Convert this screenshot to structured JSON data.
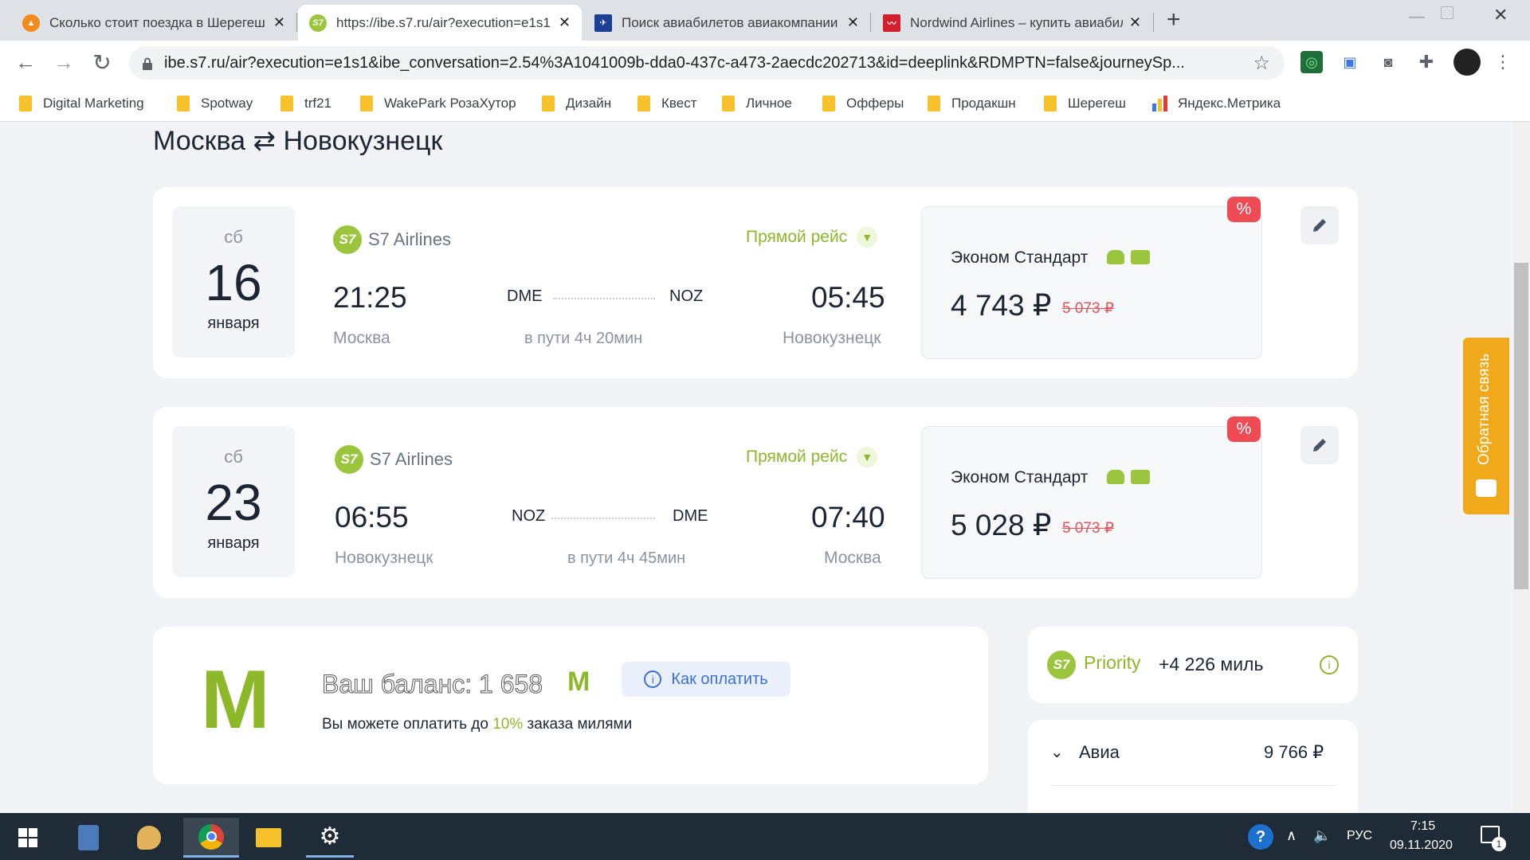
{
  "tabs": [
    {
      "title": "Сколько стоит поездка в Шерегеш",
      "favicon": "orange-circle-icon"
    },
    {
      "title": "https://ibe.s7.ru/air?execution=e1s1",
      "favicon": "s7-icon"
    },
    {
      "title": "Поиск авиабилетов авиакомпании",
      "favicon": "blue-plane-icon"
    },
    {
      "title": "Nordwind Airlines – купить авиабилеты",
      "favicon": "nordwind-icon"
    }
  ],
  "new_tab": "+",
  "url": "ibe.s7.ru/air?execution=e1s1&ibe_conversation=2.54%3A1041009b-dda0-437c-a473-2aecdc202713&id=deeplink&RDMPTN=false&journeySp...",
  "bookmarks": [
    "Digital Marketing",
    "Spotway",
    "trf21",
    "WakePark РозаХутор",
    "Дизайн",
    "Квест",
    "Личное",
    "Офферы",
    "Продакшн",
    "Шерегеш",
    "Яндекс.Метрика"
  ],
  "page": {
    "title": "Москва ⇄ Новокузнецк",
    "flights": [
      {
        "dow": "сб",
        "day": "16",
        "month": "января",
        "airline": "S7 Airlines",
        "direct": "Прямой рейс",
        "dep_time": "21:25",
        "dep_code": "DME",
        "arr_code": "NOZ",
        "arr_time": "05:45",
        "dep_city": "Москва",
        "arr_city": "Новокузнецк",
        "duration": "в пути 4ч 20мин",
        "fare": "Эконом Стандарт",
        "price": "4 743 ₽",
        "old_price": "5 073 ₽",
        "badge": "%"
      },
      {
        "dow": "сб",
        "day": "23",
        "month": "января",
        "airline": "S7 Airlines",
        "direct": "Прямой рейс",
        "dep_time": "06:55",
        "dep_code": "NOZ",
        "arr_code": "DME",
        "arr_time": "07:40",
        "dep_city": "Новокузнецк",
        "arr_city": "Москва",
        "duration": "в пути 4ч 45мин",
        "fare": "Эконом Стандарт",
        "price": "5 028 ₽",
        "old_price": "5 073 ₽",
        "badge": "%"
      }
    ],
    "miles": {
      "logo": "M",
      "balance_label": "Ваш баланс: 1 658",
      "currency": "M",
      "how_to_pay": "Как оплатить",
      "note_prefix": "Вы можете оплатить до",
      "note_pct": "10%",
      "note_suffix": "заказа милями"
    },
    "priority": {
      "logo": "S7",
      "name": "Priority",
      "miles": "+4 226 миль"
    },
    "summary": {
      "label": "Авиа",
      "amount": "9 766 ₽"
    },
    "feedback": "Обратная связь"
  },
  "taskbar": {
    "lang": "РУС",
    "time": "7:15",
    "date": "09.11.2020",
    "notifications": "1"
  },
  "colors": {
    "accent": "#9bc53d",
    "sale": "#ef4b55",
    "feedback": "#f1a91c"
  }
}
